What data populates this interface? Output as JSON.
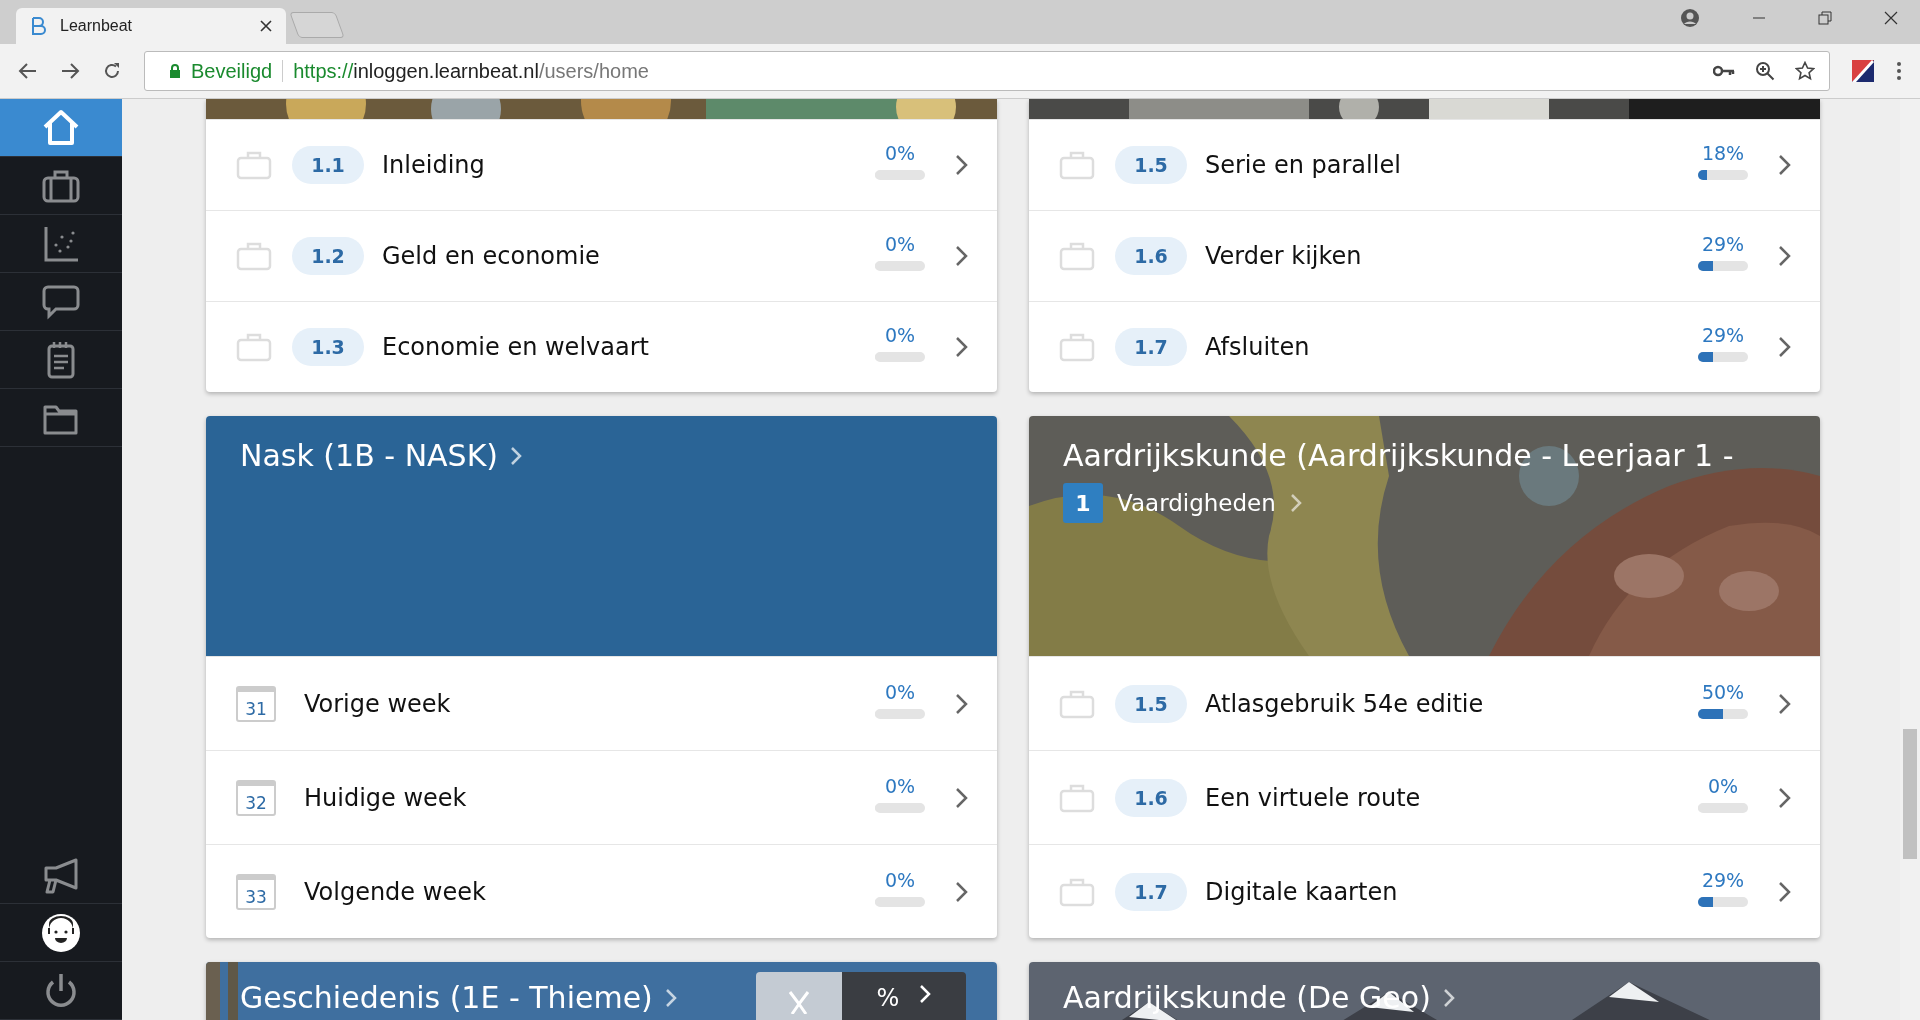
{
  "browser": {
    "tab_title": "Learnbeat",
    "secure_label": "Beveiligd",
    "url_scheme": "https://",
    "url_host": "inloggen.learnbeat.nl",
    "url_path": "/users/home"
  },
  "sidebar": {
    "items": [
      {
        "kind": "home",
        "selected": true
      },
      {
        "kind": "briefcase",
        "selected": false
      },
      {
        "kind": "chart",
        "selected": false
      },
      {
        "kind": "chat",
        "selected": false
      },
      {
        "kind": "notepad",
        "selected": false
      },
      {
        "kind": "folder",
        "selected": false
      }
    ],
    "bottom_items": [
      {
        "kind": "megaphone",
        "selected": false
      },
      {
        "kind": "avatar",
        "selected": false
      },
      {
        "kind": "power",
        "selected": false
      }
    ]
  },
  "cards": [
    {
      "rows": [
        {
          "kind": "lesson",
          "code": "1.1",
          "title": "Inleiding",
          "percent": "0%",
          "level": 0
        },
        {
          "kind": "lesson",
          "code": "1.2",
          "title": "Geld en economie",
          "percent": "0%",
          "level": 0
        },
        {
          "kind": "lesson",
          "code": "1.3",
          "title": "Economie en welvaart",
          "percent": "0%",
          "level": 0
        }
      ]
    },
    {
      "rows": [
        {
          "kind": "lesson",
          "code": "1.5",
          "title": "Serie en parallel",
          "percent": "18%",
          "level": 0.18
        },
        {
          "kind": "lesson",
          "code": "1.6",
          "title": "Verder kijken",
          "percent": "29%",
          "level": 0.29
        },
        {
          "kind": "lesson",
          "code": "1.7",
          "title": "Afsluiten",
          "percent": "29%",
          "level": 0.29
        }
      ]
    },
    {
      "header": {
        "kind": "color",
        "color": "#2a6496"
      },
      "title": "Nask (1B - NASK)",
      "rows": [
        {
          "kind": "week",
          "day": "31",
          "title": "Vorige week",
          "percent": "0%",
          "level": 0
        },
        {
          "kind": "week",
          "day": "32",
          "title": "Huidige week",
          "percent": "0%",
          "level": 0
        },
        {
          "kind": "week",
          "day": "33",
          "title": "Volgende week",
          "percent": "0%",
          "level": 0
        }
      ]
    },
    {
      "title": "Aardrijkskunde (Aardrijkskunde - Leerjaar 1 -",
      "chapter": {
        "number": "1",
        "label": "Vaardigheden"
      },
      "rows": [
        {
          "kind": "lesson",
          "code": "1.5",
          "title": "Atlasgebruik 54e editie",
          "percent": "50%",
          "level": 0.5
        },
        {
          "kind": "lesson",
          "code": "1.6",
          "title": "Een virtuele route",
          "percent": "0%",
          "level": 0
        },
        {
          "kind": "lesson",
          "code": "1.7",
          "title": "Digitale kaarten",
          "percent": "29%",
          "level": 0.29
        }
      ]
    },
    {
      "title": "Geschiedenis (1E - Thieme)",
      "progress_badge": {
        "percent": "%"
      }
    },
    {
      "title": "Aardrijkskunde (De Geo)"
    }
  ]
}
